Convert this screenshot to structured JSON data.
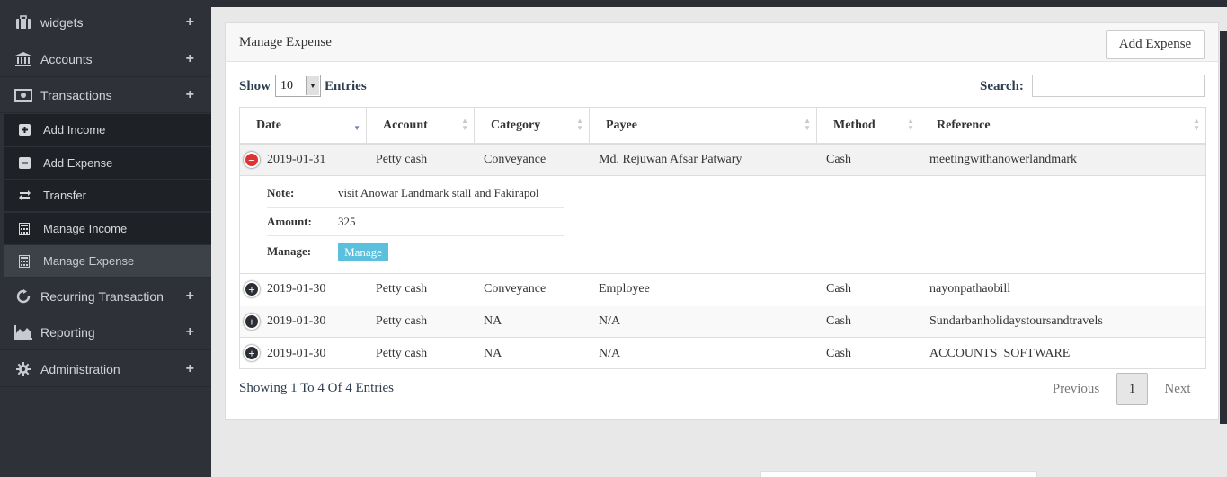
{
  "sidebar": {
    "items": [
      {
        "label": "widgets",
        "icon": "briefcase-icon"
      },
      {
        "label": "Accounts",
        "icon": "bank-icon"
      },
      {
        "label": "Transactions",
        "icon": "money-icon"
      },
      {
        "label": "Recurring Transaction",
        "icon": "refresh-icon"
      },
      {
        "label": "Reporting",
        "icon": "area-chart-icon"
      },
      {
        "label": "Administration",
        "icon": "gear-icon"
      }
    ],
    "expand_symbol": "+",
    "sub_items": [
      {
        "label": "Add Income",
        "icon": "plus-square-icon"
      },
      {
        "label": "Add Expense",
        "icon": "minus-square-icon"
      },
      {
        "label": "Transfer",
        "icon": "transfer-icon"
      },
      {
        "label": "Manage Income",
        "icon": "calculator-icon"
      },
      {
        "label": "Manage Expense",
        "icon": "calculator-icon",
        "active": true
      }
    ]
  },
  "panel": {
    "title": "Manage Expense",
    "add_button": "Add Expense"
  },
  "controls": {
    "show_label": "Show",
    "show_value": "10",
    "entries_label": "Entries",
    "search_label": "Search:",
    "search_value": ""
  },
  "table": {
    "columns": [
      "Date",
      "Account",
      "Category",
      "Payee",
      "Method",
      "Reference"
    ],
    "rows": [
      {
        "date": "2019-01-31",
        "account": "Petty cash",
        "category": "Conveyance",
        "payee": "Md. Rejuwan Afsar Patwary",
        "method": "Cash",
        "reference": "meetingwithanowerlandmark",
        "expanded": true
      },
      {
        "date": "2019-01-30",
        "account": "Petty cash",
        "category": "Conveyance",
        "payee": "Employee",
        "method": "Cash",
        "reference": "nayonpathaobill"
      },
      {
        "date": "2019-01-30",
        "account": "Petty cash",
        "category": "NA",
        "payee": "N/A",
        "method": "Cash",
        "reference": "Sundarbanholidaystoursandtravels"
      },
      {
        "date": "2019-01-30",
        "account": "Petty cash",
        "category": "NA",
        "payee": "N/A",
        "method": "Cash",
        "reference": "ACCOUNTS_SOFTWARE"
      }
    ],
    "detail": {
      "note_label": "Note:",
      "note_value": "visit Anowar Landmark stall and Fakirapol",
      "amount_label": "Amount:",
      "amount_value": "325",
      "manage_label": "Manage:",
      "manage_button": "Manage"
    }
  },
  "footer": {
    "info": "Showing 1 To 4 Of 4 Entries",
    "previous": "Previous",
    "current_page": "1",
    "next": "Next"
  }
}
